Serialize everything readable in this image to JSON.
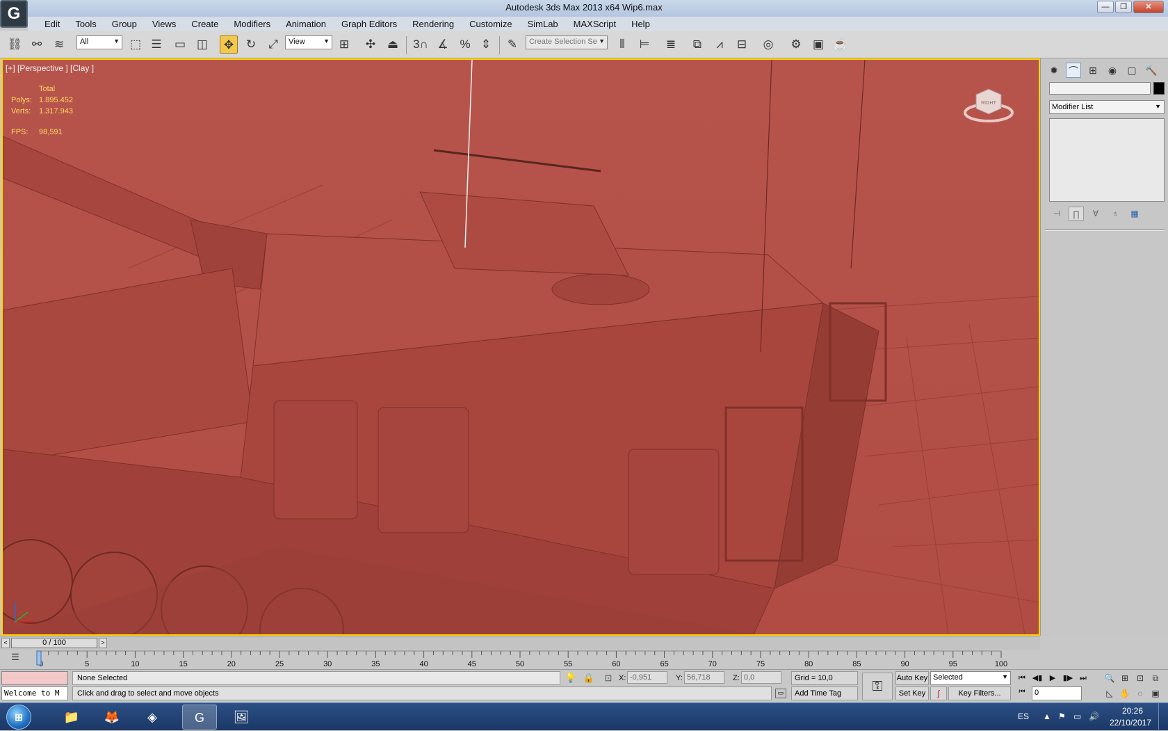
{
  "window": {
    "title": "Autodesk 3ds Max  2013 x64     Wip6.max",
    "controls": [
      "—",
      "❐",
      "✕"
    ]
  },
  "menu": [
    "Edit",
    "Tools",
    "Group",
    "Views",
    "Create",
    "Modifiers",
    "Animation",
    "Graph Editors",
    "Rendering",
    "Customize",
    "SimLab",
    "MAXScript",
    "Help"
  ],
  "toolbar": {
    "selection_filter": "All",
    "ref_coord": "View",
    "named_selection_placeholder": "Create Selection Se",
    "snap_label": "3",
    "percent_snap_label": "%",
    "active_tool": "select-and-move"
  },
  "viewport": {
    "label": "[+] [Perspective ] [Clay ]",
    "stats": {
      "header": "Total",
      "polys_label": "Polys:",
      "polys": "1.895.452",
      "verts_label": "Verts:",
      "verts": "1.317.943",
      "fps_label": "FPS:",
      "fps": "98,591"
    },
    "viewcube_label": "RIGHT",
    "border_color": "#ffd400",
    "clay_color": "#b5524a"
  },
  "command_panel": {
    "modifier_list": "Modifier List"
  },
  "time_slider": {
    "position": "0 / 100",
    "left_arrow": "<",
    "right_arrow": ">"
  },
  "track_bar": {
    "start": 0,
    "end": 100,
    "major_ticks": [
      0,
      5,
      10,
      15,
      20,
      25,
      30,
      35,
      40,
      45,
      50,
      55,
      60,
      65,
      70,
      75,
      80,
      85,
      90,
      95,
      100
    ]
  },
  "status": {
    "listener_text": "Welcome to M",
    "selection": "None Selected",
    "prompt": "Click and drag to select and move objects",
    "x_label": "X:",
    "x_value": "-0,951",
    "y_label": "Y:",
    "y_value": "56,718",
    "z_label": "Z:",
    "z_value": "0,0",
    "grid": "Grid = 10,0",
    "add_time_tag": "Add Time Tag",
    "auto_key": "Auto Key",
    "set_key": "Set Key",
    "key_set": "Selected",
    "key_filters": "Key Filters...",
    "current_frame": "0"
  },
  "taskbar": {
    "start_label": "⊞",
    "apps": [
      "folder",
      "firefox",
      "3ds-max-object",
      "3ds-max",
      "image-viewer"
    ],
    "language": "ES",
    "time": "20:26",
    "date": "22/10/2017"
  }
}
